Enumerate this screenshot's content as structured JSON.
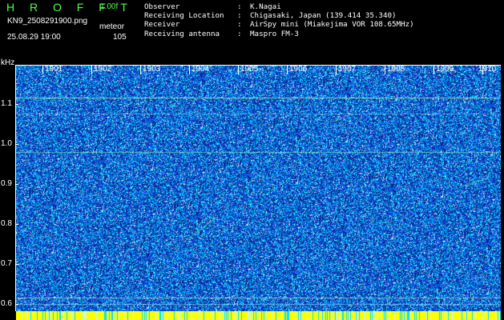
{
  "header": {
    "app_title": "H R O F F T",
    "version": "1.00f",
    "filename": "KN9_2508291900.png",
    "datetime": "25.08.29 19:00",
    "mode": "meteor",
    "count": "105"
  },
  "info": [
    {
      "label": "Observer",
      "colon": ":",
      "value": "K.Nagai"
    },
    {
      "label": "Receiving Location",
      "colon": ":",
      "value": "Chigasaki, Japan (139.414 35.340)"
    },
    {
      "label": "Receiver",
      "colon": ":",
      "value": "AirSpy mini (Miakejima VOR 108.65MHz)"
    },
    {
      "label": "Receiving antenna",
      "colon": ":",
      "value": "Maspro FM-3"
    }
  ],
  "axis": {
    "y_unit": "kHz",
    "y_ticks": [
      "1.1",
      "1.0",
      "0.9",
      "0.8",
      "0.7",
      "0.6"
    ],
    "x_ticks": [
      "1901",
      "1902",
      "1903",
      "1904",
      "1905",
      "1906",
      "1907",
      "1908",
      "1909",
      "1910"
    ]
  },
  "colors": {
    "title_green": "#4cff4c",
    "background": "#000000",
    "spectrogram_base": "#0a2a8c",
    "noise_cyan": "#00d8ff",
    "noise_blue": "#1e50ff",
    "noise_white": "#ffffff",
    "strip_yellow": "#ffff00"
  }
}
